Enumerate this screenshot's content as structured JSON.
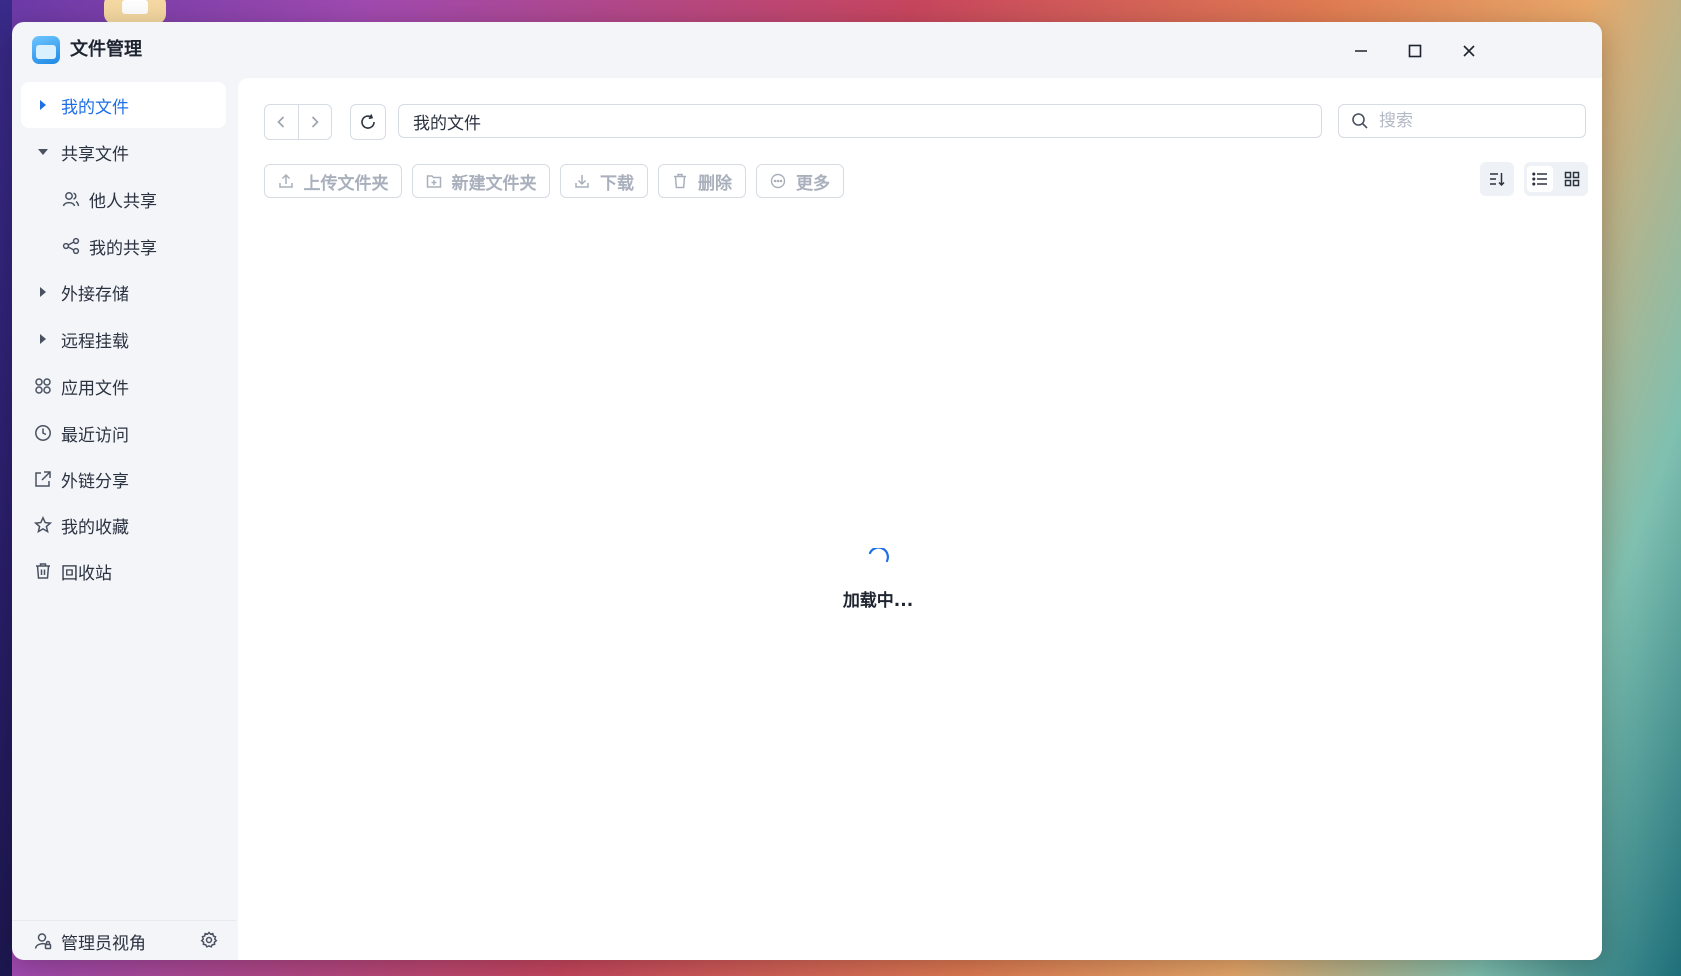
{
  "window": {
    "title": "文件管理"
  },
  "sidebar": {
    "items": [
      {
        "label": "我的文件",
        "icon": "caret-right-icon",
        "active": true
      },
      {
        "label": "共享文件",
        "icon": "caret-down-icon"
      },
      {
        "label": "他人共享",
        "icon": "users-icon"
      },
      {
        "label": "我的共享",
        "icon": "share-nodes-icon"
      },
      {
        "label": "外接存储",
        "icon": "caret-right-icon"
      },
      {
        "label": "远程挂载",
        "icon": "caret-right-icon"
      },
      {
        "label": "应用文件",
        "icon": "apps-icon"
      },
      {
        "label": "最近访问",
        "icon": "clock-icon"
      },
      {
        "label": "外链分享",
        "icon": "external-share-icon"
      },
      {
        "label": "我的收藏",
        "icon": "star-icon"
      },
      {
        "label": "回收站",
        "icon": "trash-icon"
      }
    ],
    "bottom": {
      "label": "管理员视角",
      "icon": "admin-user-icon",
      "settings_icon": "gear-icon"
    }
  },
  "toolbar": {
    "path": "我的文件",
    "search_placeholder": "搜索",
    "actions": [
      {
        "label": "上传文件夹",
        "icon": "upload-icon"
      },
      {
        "label": "新建文件夹",
        "icon": "new-folder-icon"
      },
      {
        "label": "下载",
        "icon": "download-icon"
      },
      {
        "label": "删除",
        "icon": "trash-icon"
      },
      {
        "label": "更多",
        "icon": "more-icon"
      }
    ]
  },
  "content": {
    "loading_text": "加载中..."
  },
  "colors": {
    "accent": "#1e6fe6",
    "disabled_text": "#a9b0bc",
    "sidebar_bg": "#f3f5f9"
  }
}
